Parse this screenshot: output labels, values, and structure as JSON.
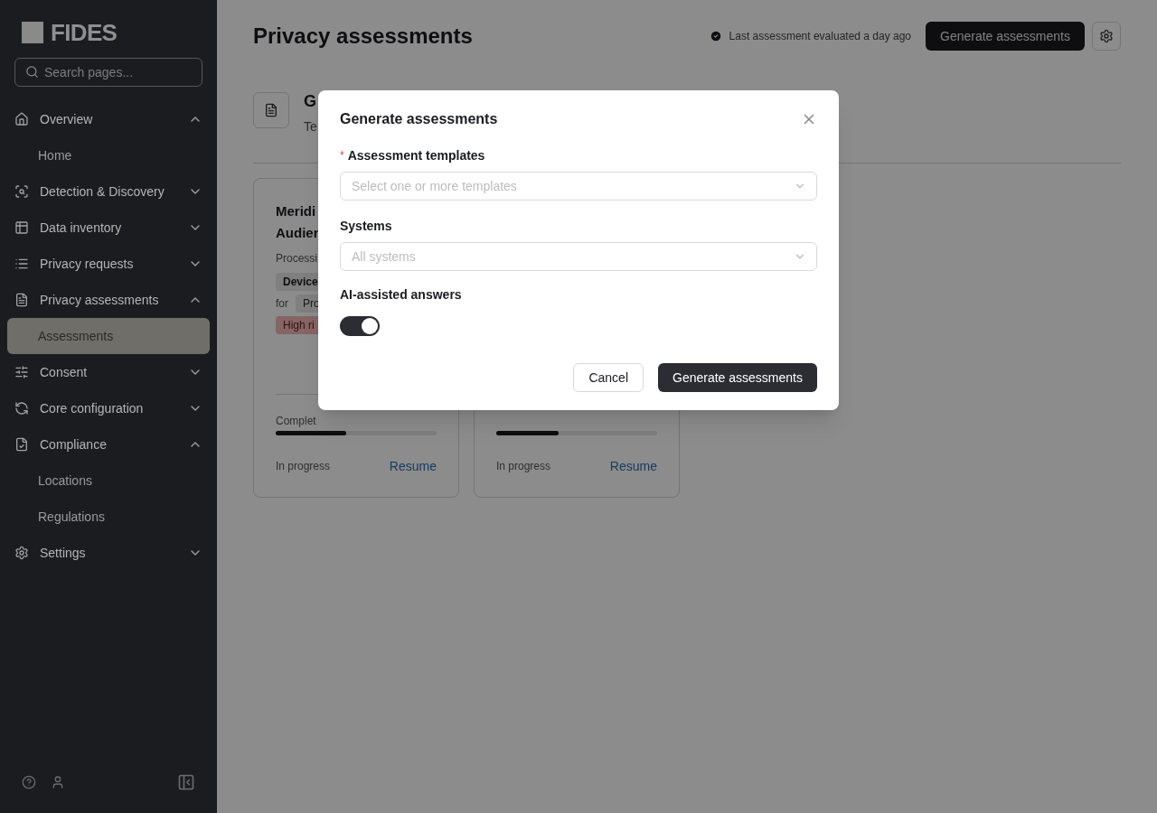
{
  "sidebar": {
    "logo": "FIDES",
    "search": {
      "placeholder": "Search pages..."
    },
    "items": [
      {
        "label": "Overview",
        "expanded": true,
        "children": [
          {
            "label": "Home",
            "selected": false
          }
        ]
      },
      {
        "label": "Detection & Discovery",
        "expanded": false
      },
      {
        "label": "Data inventory",
        "expanded": false
      },
      {
        "label": "Privacy requests",
        "expanded": false
      },
      {
        "label": "Privacy assessments",
        "expanded": true,
        "children": [
          {
            "label": "Assessments",
            "selected": true
          }
        ]
      },
      {
        "label": "Consent",
        "expanded": false
      },
      {
        "label": "Core configuration",
        "expanded": false
      },
      {
        "label": "Compliance",
        "expanded": true,
        "children": [
          {
            "label": "Locations",
            "selected": false
          },
          {
            "label": "Regulations",
            "selected": false
          }
        ]
      },
      {
        "label": "Settings",
        "expanded": false
      }
    ]
  },
  "header": {
    "title": "Privacy assessments",
    "status": "Last assessment evaluated a day ago",
    "button": "Generate assessments"
  },
  "section": {
    "title": "G",
    "subtitle": "Te"
  },
  "cards": [
    {
      "title": [
        "Meridi",
        "Audien"
      ],
      "label": "Processi",
      "tag": "Device",
      "for": "for",
      "subject": "Pro",
      "risk": "High ri",
      "progress_label": "Complet",
      "level": 0.44,
      "status": "In progress",
      "action": "Resume"
    },
    {
      "level": 0.39,
      "status": "In progress",
      "action": "Resume"
    }
  ],
  "modal": {
    "title": "Generate assessments",
    "fields": [
      {
        "kind": "select",
        "label": "Assessment templates",
        "required_mark": "*",
        "placeholder": "Select one or more templates"
      },
      {
        "kind": "select",
        "label": "Systems",
        "placeholder": "All systems"
      },
      {
        "kind": "switch",
        "label": "AI-assisted answers",
        "on": true
      }
    ],
    "buttons": [
      {
        "label": "Cancel",
        "primary": false
      },
      {
        "label": "Generate assessments",
        "primary": true
      }
    ]
  }
}
